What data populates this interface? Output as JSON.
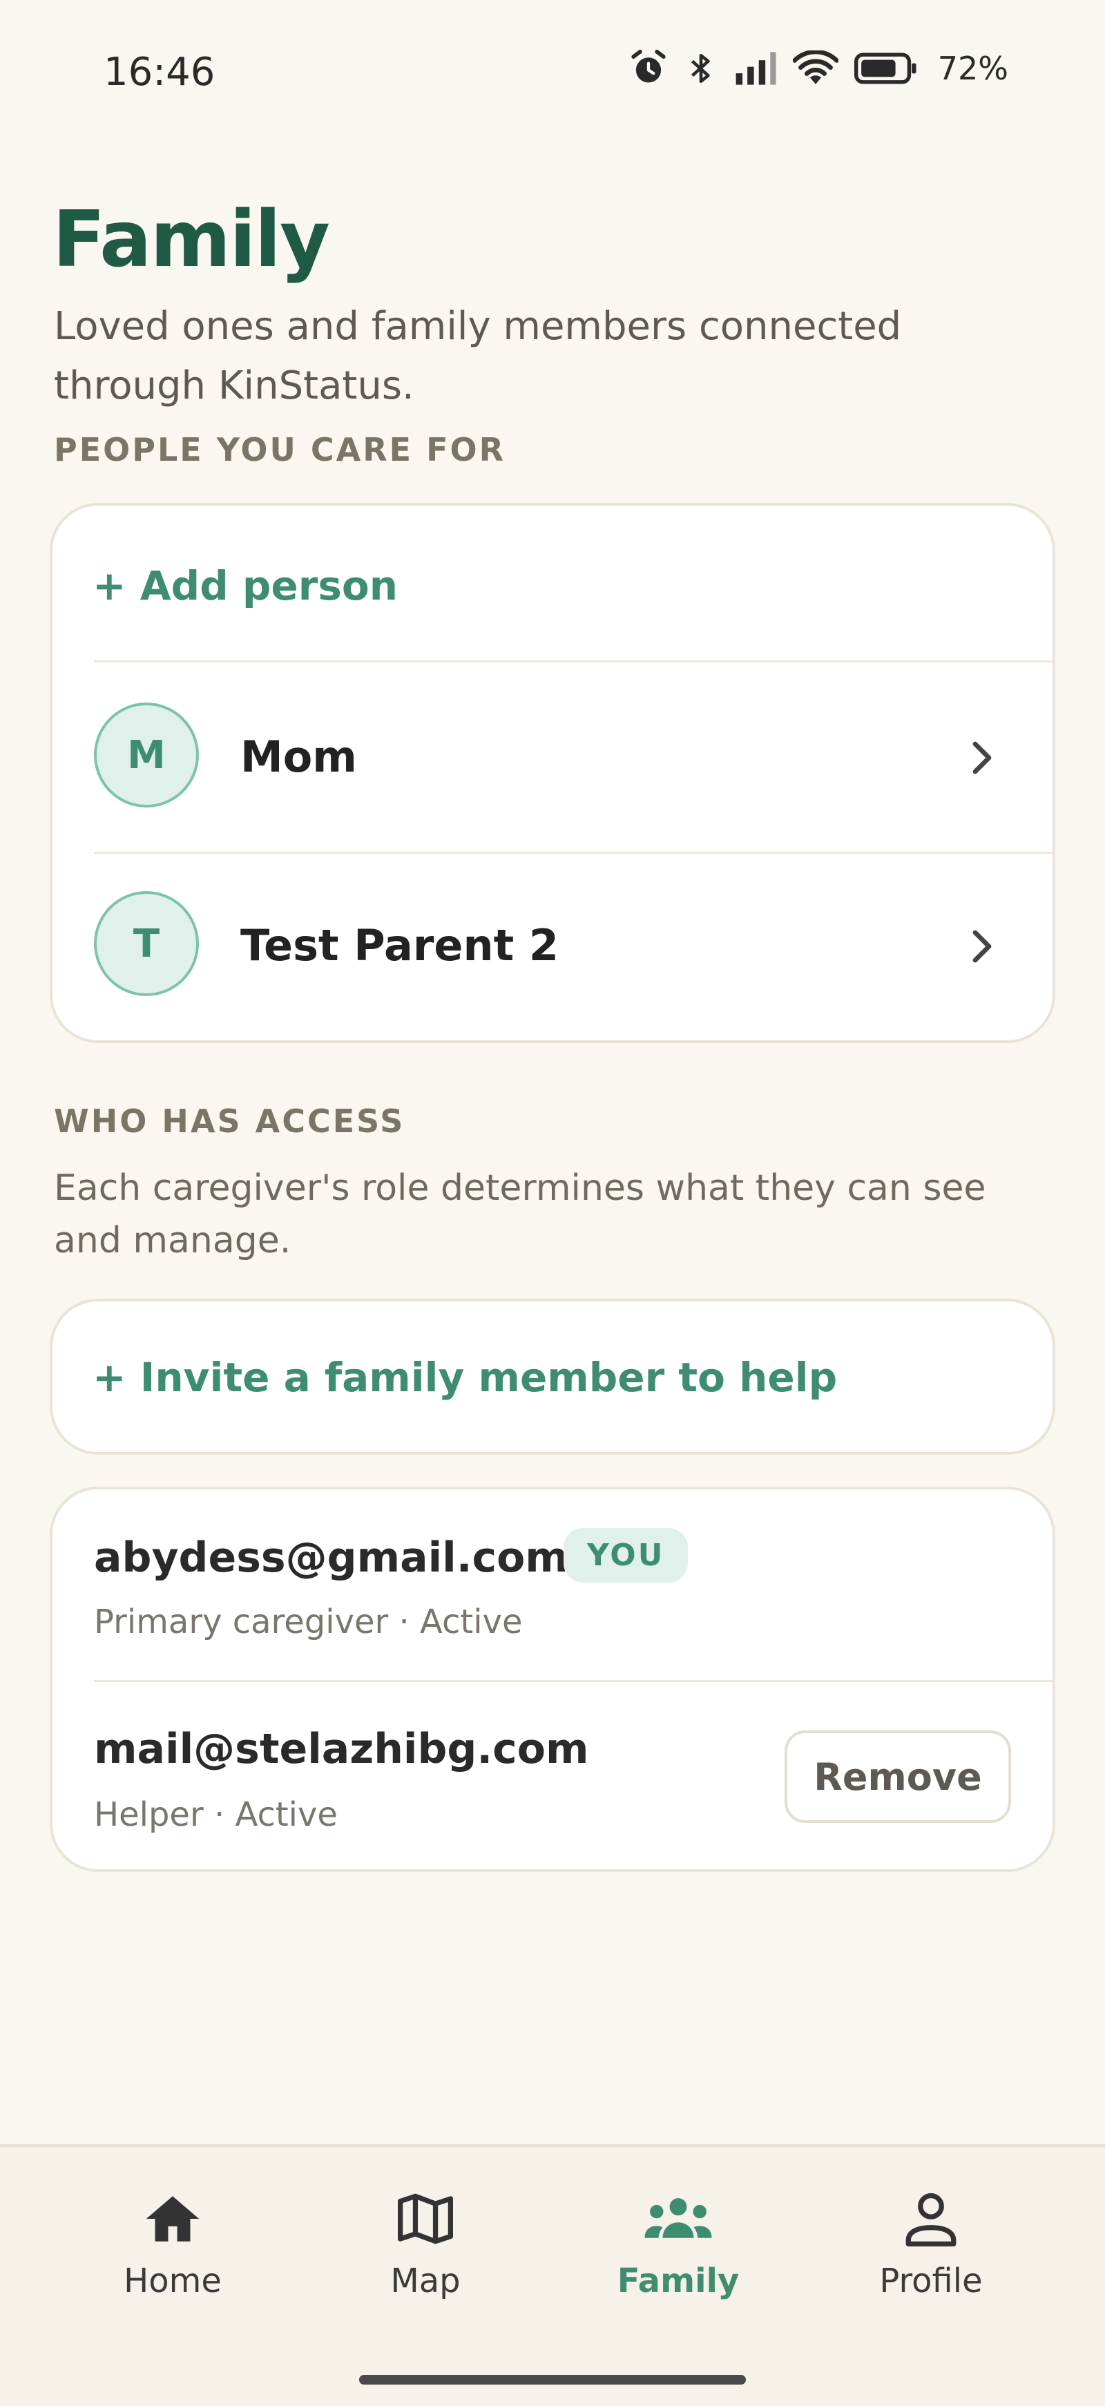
{
  "status_bar": {
    "time": "16:46",
    "battery_percent": "72%"
  },
  "header": {
    "title": "Family",
    "subtitle": "Loved ones and family members connected through KinStatus."
  },
  "people_section": {
    "label": "PEOPLE YOU CARE FOR",
    "add_label": "+ Add person",
    "people": [
      {
        "initial": "M",
        "name": "Mom"
      },
      {
        "initial": "T",
        "name": "Test Parent 2"
      }
    ]
  },
  "access_section": {
    "label": "WHO HAS ACCESS",
    "description": "Each caregiver's role determines what they can see and manage.",
    "invite_label": "+ Invite a family member to help",
    "members": [
      {
        "email": "abydess@gmail.com",
        "badge": "YOU",
        "role": "Primary caregiver · Active"
      },
      {
        "email": "mail@stelazhibg.com",
        "role": "Helper · Active",
        "action": "Remove"
      }
    ]
  },
  "nav": {
    "items": [
      {
        "label": "Home",
        "icon": "home-icon"
      },
      {
        "label": "Map",
        "icon": "map-icon"
      },
      {
        "label": "Family",
        "icon": "family-icon",
        "active": true
      },
      {
        "label": "Profile",
        "icon": "profile-icon"
      }
    ]
  },
  "colors": {
    "accent": "#3f8d70",
    "title": "#1f5a45",
    "background": "#faf7f0"
  }
}
